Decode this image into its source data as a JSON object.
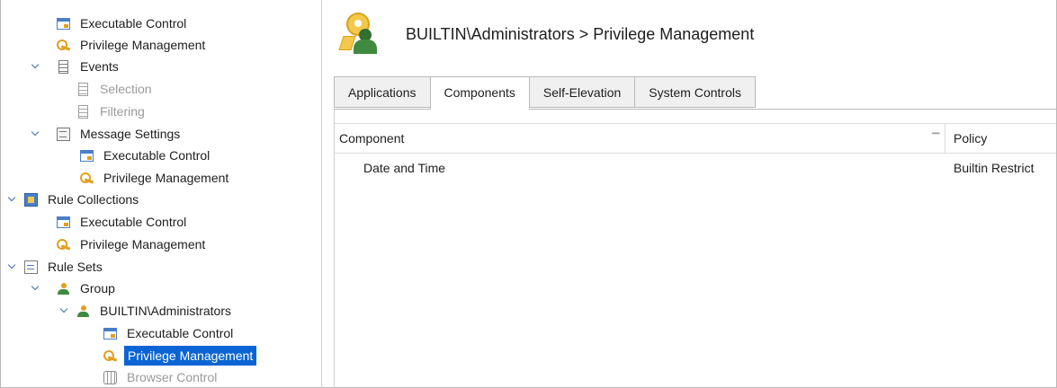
{
  "tree": {
    "items": [
      {
        "label": "Executable Control",
        "icon": "executable-control-icon",
        "disabled": false,
        "expanded": false
      },
      {
        "label": "Privilege Management",
        "icon": "privilege-key-icon",
        "disabled": false,
        "expanded": false
      },
      {
        "label": "Events",
        "icon": "document-icon",
        "disabled": false,
        "expanded": true
      },
      {
        "label": "Selection",
        "icon": "document-icon",
        "disabled": true,
        "expanded": false
      },
      {
        "label": "Filtering",
        "icon": "document-icon",
        "disabled": true,
        "expanded": false
      },
      {
        "label": "Message Settings",
        "icon": "message-icon",
        "disabled": false,
        "expanded": true
      },
      {
        "label": "Executable Control",
        "icon": "executable-control-icon",
        "disabled": false,
        "expanded": false
      },
      {
        "label": "Privilege Management",
        "icon": "privilege-key-icon",
        "disabled": false,
        "expanded": false
      },
      {
        "label": "Rule Collections",
        "icon": "rule-collections-icon",
        "disabled": false,
        "expanded": true
      },
      {
        "label": "Executable Control",
        "icon": "executable-control-icon",
        "disabled": false,
        "expanded": false
      },
      {
        "label": "Privilege Management",
        "icon": "privilege-key-icon",
        "disabled": false,
        "expanded": false
      },
      {
        "label": "Rule Sets",
        "icon": "rule-sets-icon",
        "disabled": false,
        "expanded": true
      },
      {
        "label": "Group",
        "icon": "group-icon",
        "disabled": false,
        "expanded": true
      },
      {
        "label": "BUILTIN\\Administrators",
        "icon": "group-icon",
        "disabled": false,
        "expanded": true
      },
      {
        "label": "Executable Control",
        "icon": "executable-control-icon",
        "disabled": false,
        "expanded": false
      },
      {
        "label": "Privilege Management",
        "icon": "privilege-key-icon",
        "disabled": false,
        "expanded": false,
        "selected": true
      },
      {
        "label": "Browser Control",
        "icon": "browser-control-icon",
        "disabled": true,
        "expanded": false
      }
    ],
    "selected_color": "#0a64d4"
  },
  "header": {
    "title": "BUILTIN\\Administrators > Privilege Management",
    "icon": "privilege-management-key-icon"
  },
  "tabs": [
    {
      "label": "Applications",
      "active": false
    },
    {
      "label": "Components",
      "active": true
    },
    {
      "label": "Self-Elevation",
      "active": false
    },
    {
      "label": "System Controls",
      "active": false
    }
  ],
  "grid": {
    "columns": {
      "component": "Component",
      "policy": "Policy"
    },
    "rows": [
      {
        "component": "Date and Time",
        "policy": "Builtin Restrict"
      }
    ]
  }
}
